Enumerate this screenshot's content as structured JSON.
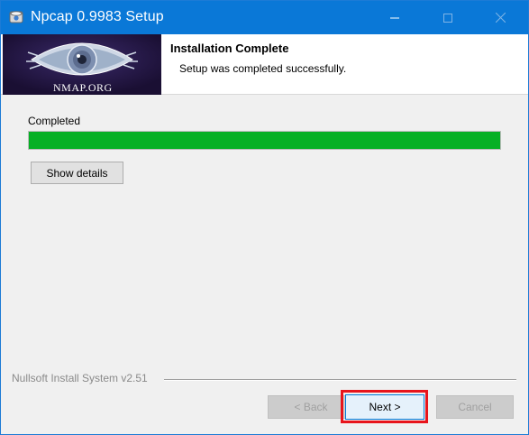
{
  "window": {
    "title": "Npcap 0.9983 Setup",
    "controls": {
      "minimize_icon": "minimize-icon",
      "maximize_icon": "maximize-icon",
      "close_icon": "close-icon"
    }
  },
  "header": {
    "banner_text": "NMAP.ORG",
    "title": "Installation Complete",
    "subtitle": "Setup was completed successfully."
  },
  "content": {
    "status_label": "Completed",
    "progress_fraction": 1.0,
    "show_details_label": "Show details"
  },
  "footer": {
    "branding": "Nullsoft Install System v2.51",
    "back_label": "< Back",
    "next_label": "Next >",
    "cancel_label": "Cancel"
  },
  "colors": {
    "titlebar": "#0a78d7",
    "progress": "#06b025",
    "highlight": "#e8141b"
  }
}
